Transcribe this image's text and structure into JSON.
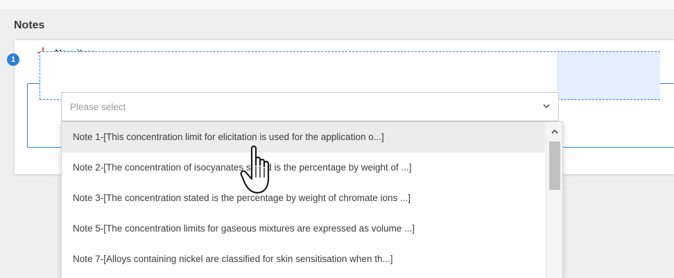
{
  "section": {
    "title": "Notes"
  },
  "toolbar": {
    "new_item_label": "New item",
    "new_item_icon": "plus-icon",
    "accent": "#e8531e"
  },
  "item": {
    "number": "1",
    "accent": "#2f7fd6"
  },
  "select": {
    "placeholder": "Please select",
    "icon": "chevron-down-icon",
    "options": [
      {
        "label": "Note 1-[This concentration limit for elicitation is used for the application o...]",
        "hovered": true
      },
      {
        "label": "Note 2-[The concentration of isocyanates stated is the percentage by weight of ...]",
        "hovered": false
      },
      {
        "label": "Note 3-[The concentration stated is the percentage by weight of chromate ions ...]",
        "hovered": false
      },
      {
        "label": "Note 5-[The concentration limits for gaseous mixtures are expressed as volume ...]",
        "hovered": false
      },
      {
        "label": "Note 7-[Alloys containing nickel are classified for skin sensitisation when th...]",
        "hovered": false
      }
    ]
  },
  "cursor": {
    "icon": "hand-pointer-icon"
  }
}
